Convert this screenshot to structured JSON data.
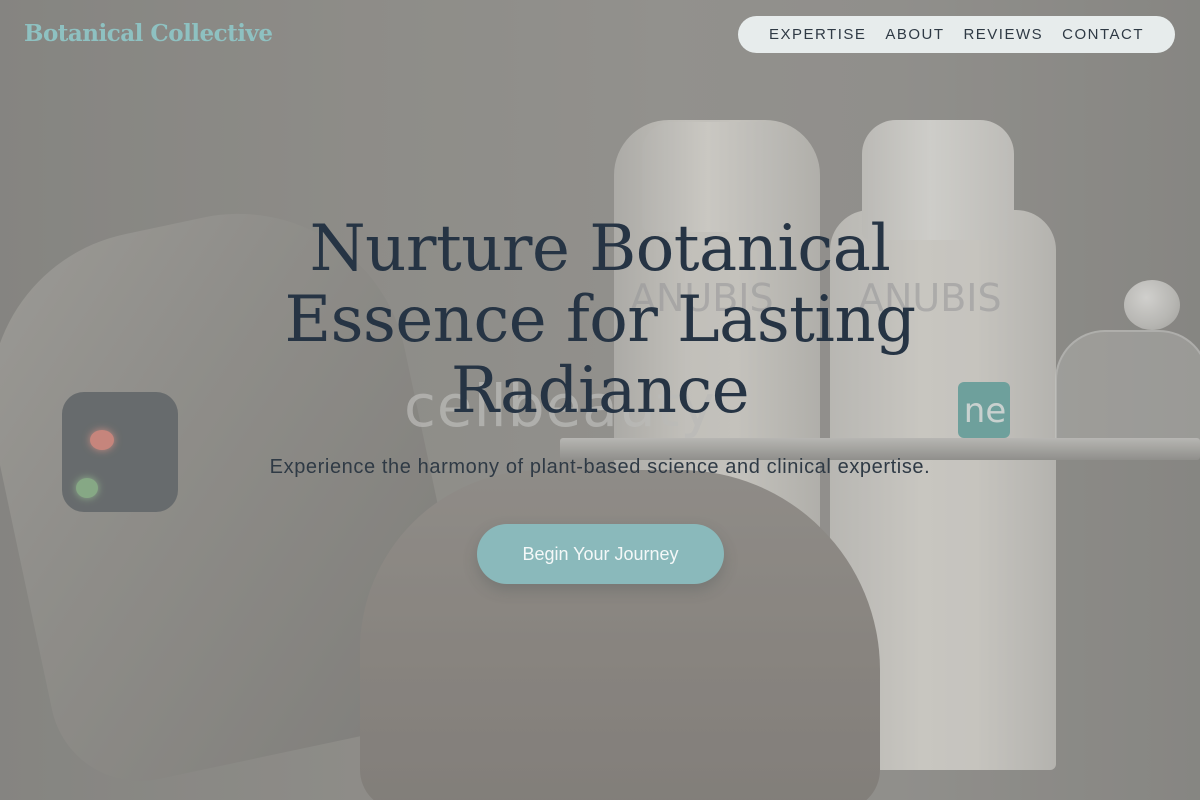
{
  "header": {
    "logo": "Botanical Collective",
    "nav": [
      {
        "label": "EXPERTISE"
      },
      {
        "label": "ABOUT"
      },
      {
        "label": "REVIEWS"
      },
      {
        "label": "CONTACT"
      }
    ]
  },
  "hero": {
    "headline_line1": "Nurture Botanical",
    "headline_line2": "Essence for Lasting",
    "headline_line3": "Radiance",
    "subtitle": "Experience the harmony of plant-based science and clinical expertise.",
    "cta_label": "Begin Your Journey"
  },
  "background_photo": {
    "bottle_brand_left": "ANUBIS",
    "bottle_brand_right": "ANUBIS",
    "bottle_label_short": "ne",
    "device_text": "cellbeauty"
  },
  "colors": {
    "logo": "#8ec1c1",
    "headline": "#263444",
    "cta_background": "#8ab9bb",
    "nav_background": "#e7ecec"
  }
}
